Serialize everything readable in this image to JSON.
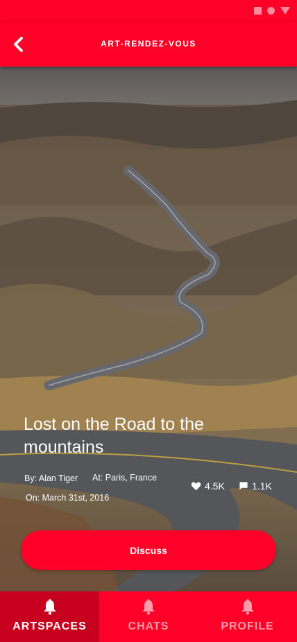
{
  "app_bar": {
    "title": "ART-RENDEZ-VOUS"
  },
  "post": {
    "title": "Lost on the Road to the mountains",
    "by": "By: Alan Tiger",
    "at": "At: Paris, France",
    "on": "On: March 31st, 2016",
    "likes": "4.5K",
    "comments": "1.1K",
    "discuss_label": "Discuss"
  },
  "nav": {
    "items": [
      {
        "label": "ARTSPACES"
      },
      {
        "label": "CHATS"
      },
      {
        "label": "PROFILE"
      }
    ]
  },
  "colors": {
    "primary": "#ff0028",
    "primary_dark": "#c8001f",
    "inactive": "#ff9aa8"
  }
}
